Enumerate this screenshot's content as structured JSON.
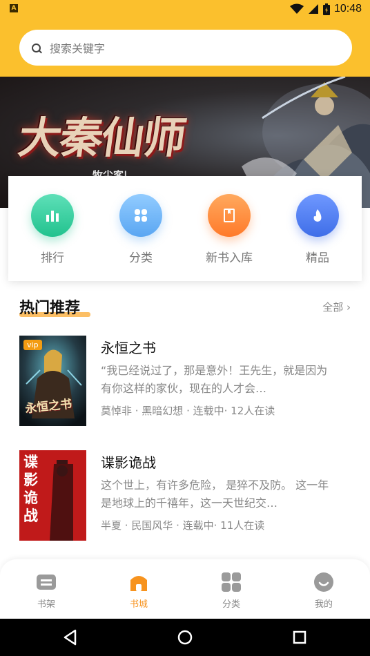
{
  "status_bar": {
    "time": "10:48",
    "app_badge": "A"
  },
  "search": {
    "placeholder": "搜索关键字"
  },
  "banner": {
    "title": "大秦仙师",
    "subtitle": "牧尘客|"
  },
  "quick_entries": [
    {
      "label": "排行",
      "icon": "bar-chart-icon",
      "color": "#2ecc9a"
    },
    {
      "label": "分类",
      "icon": "grid-icon",
      "color": "#6cb4f5"
    },
    {
      "label": "新书入库",
      "icon": "book-icon",
      "color": "#ff8a3d"
    },
    {
      "label": "精品",
      "icon": "flame-icon",
      "color": "#4f7df0"
    }
  ],
  "section": {
    "title": "热门推荐",
    "more_label": "全部 ›"
  },
  "books": [
    {
      "title": "永恒之书",
      "description": "“我已经说过了，那是意外！王先生，就是因为有你这样的家伙，现在的人才会…",
      "meta": "莫悼非 · 黑暗幻想 · 连载中· 12人在读",
      "badge": "vip",
      "cover_text": "永恒之书"
    },
    {
      "title": "谍影诡战",
      "description": "这个世上，有许多危险， 是猝不及防。 这一年是地球上的千禧年，这一天世纪交…",
      "meta": "半夏 · 民国风华 · 连载中· 11人在读",
      "badge": "",
      "cover_text": "谍影诡战"
    }
  ],
  "tab_bar": [
    {
      "label": "书架",
      "icon": "bookshelf-icon",
      "active": false
    },
    {
      "label": "书城",
      "icon": "home-icon",
      "active": true
    },
    {
      "label": "分类",
      "icon": "category-icon",
      "active": false
    },
    {
      "label": "我的",
      "icon": "profile-icon",
      "active": false
    }
  ],
  "colors": {
    "accent": "#fbc02d",
    "active_tab": "#f7931e"
  }
}
